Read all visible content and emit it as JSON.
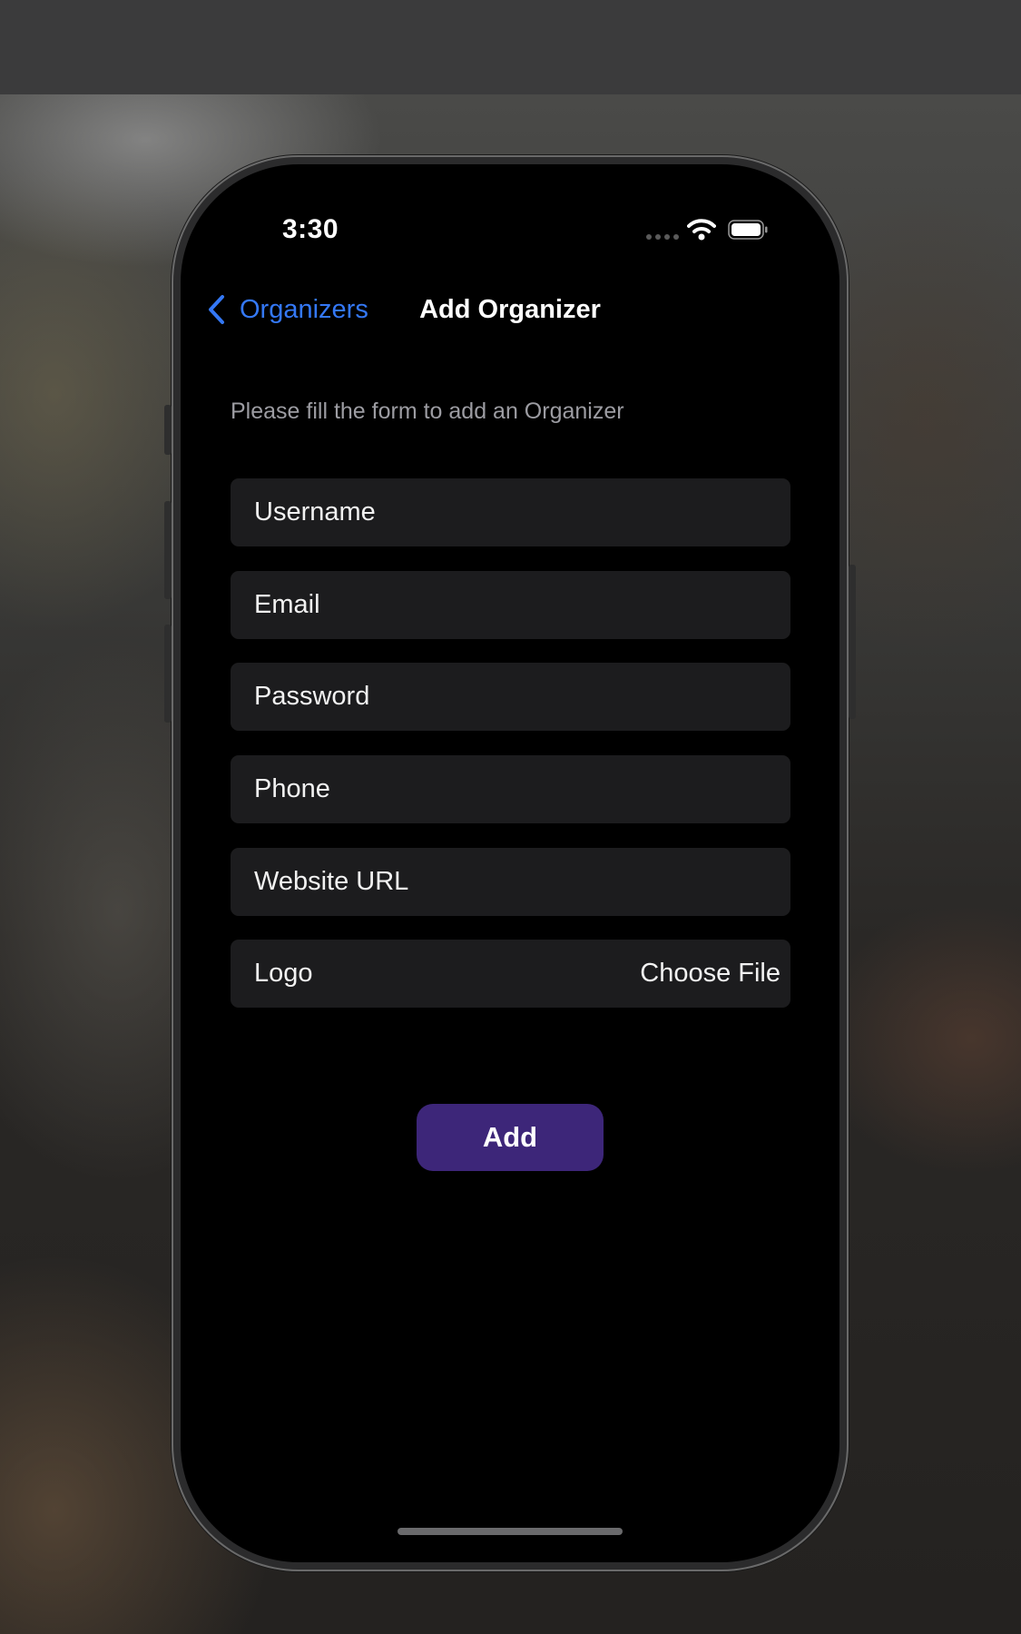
{
  "status_bar": {
    "time": "3:30"
  },
  "nav": {
    "back_label": "Organizers",
    "title": "Add Organizer"
  },
  "form": {
    "intro": "Please fill the form to add an Organizer",
    "username_placeholder": "Username",
    "email_placeholder": "Email",
    "password_placeholder": "Password",
    "phone_placeholder": "Phone",
    "website_placeholder": "Website URL",
    "logo_label": "Logo",
    "choose_file_label": "Choose File",
    "submit_label": "Add"
  },
  "icons": {
    "back": "chevron-left-icon",
    "signal": "cellular-signal-icon",
    "wifi": "wifi-icon",
    "battery": "battery-icon"
  },
  "colors": {
    "accent": "#3478f6",
    "submit_button": "#3d2679",
    "field_background": "#1c1c1e",
    "screen_background": "#000000",
    "secondary_text": "#9c9ca2"
  }
}
